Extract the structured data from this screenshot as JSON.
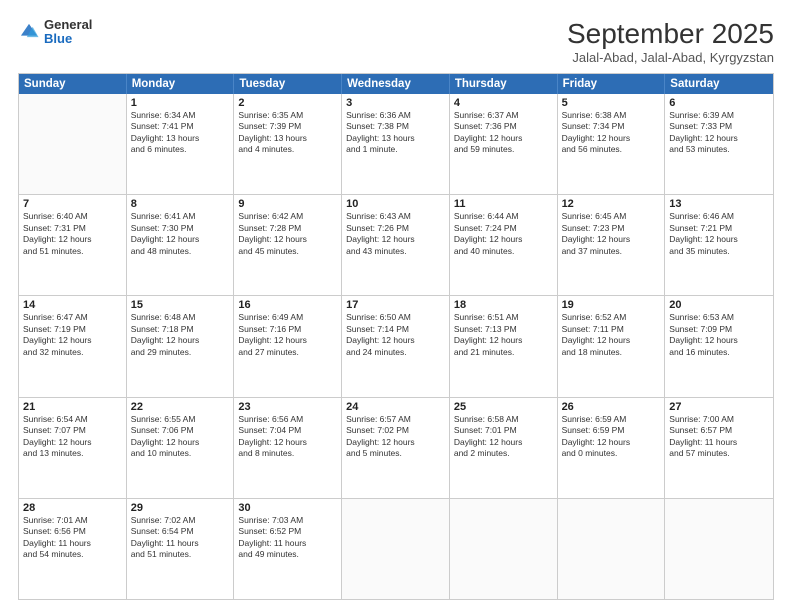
{
  "header": {
    "logo_general": "General",
    "logo_blue": "Blue",
    "month_title": "September 2025",
    "location": "Jalal-Abad, Jalal-Abad, Kyrgyzstan"
  },
  "weekdays": [
    "Sunday",
    "Monday",
    "Tuesday",
    "Wednesday",
    "Thursday",
    "Friday",
    "Saturday"
  ],
  "weeks": [
    [
      {
        "day": "",
        "lines": []
      },
      {
        "day": "1",
        "lines": [
          "Sunrise: 6:34 AM",
          "Sunset: 7:41 PM",
          "Daylight: 13 hours",
          "and 6 minutes."
        ]
      },
      {
        "day": "2",
        "lines": [
          "Sunrise: 6:35 AM",
          "Sunset: 7:39 PM",
          "Daylight: 13 hours",
          "and 4 minutes."
        ]
      },
      {
        "day": "3",
        "lines": [
          "Sunrise: 6:36 AM",
          "Sunset: 7:38 PM",
          "Daylight: 13 hours",
          "and 1 minute."
        ]
      },
      {
        "day": "4",
        "lines": [
          "Sunrise: 6:37 AM",
          "Sunset: 7:36 PM",
          "Daylight: 12 hours",
          "and 59 minutes."
        ]
      },
      {
        "day": "5",
        "lines": [
          "Sunrise: 6:38 AM",
          "Sunset: 7:34 PM",
          "Daylight: 12 hours",
          "and 56 minutes."
        ]
      },
      {
        "day": "6",
        "lines": [
          "Sunrise: 6:39 AM",
          "Sunset: 7:33 PM",
          "Daylight: 12 hours",
          "and 53 minutes."
        ]
      }
    ],
    [
      {
        "day": "7",
        "lines": [
          "Sunrise: 6:40 AM",
          "Sunset: 7:31 PM",
          "Daylight: 12 hours",
          "and 51 minutes."
        ]
      },
      {
        "day": "8",
        "lines": [
          "Sunrise: 6:41 AM",
          "Sunset: 7:30 PM",
          "Daylight: 12 hours",
          "and 48 minutes."
        ]
      },
      {
        "day": "9",
        "lines": [
          "Sunrise: 6:42 AM",
          "Sunset: 7:28 PM",
          "Daylight: 12 hours",
          "and 45 minutes."
        ]
      },
      {
        "day": "10",
        "lines": [
          "Sunrise: 6:43 AM",
          "Sunset: 7:26 PM",
          "Daylight: 12 hours",
          "and 43 minutes."
        ]
      },
      {
        "day": "11",
        "lines": [
          "Sunrise: 6:44 AM",
          "Sunset: 7:24 PM",
          "Daylight: 12 hours",
          "and 40 minutes."
        ]
      },
      {
        "day": "12",
        "lines": [
          "Sunrise: 6:45 AM",
          "Sunset: 7:23 PM",
          "Daylight: 12 hours",
          "and 37 minutes."
        ]
      },
      {
        "day": "13",
        "lines": [
          "Sunrise: 6:46 AM",
          "Sunset: 7:21 PM",
          "Daylight: 12 hours",
          "and 35 minutes."
        ]
      }
    ],
    [
      {
        "day": "14",
        "lines": [
          "Sunrise: 6:47 AM",
          "Sunset: 7:19 PM",
          "Daylight: 12 hours",
          "and 32 minutes."
        ]
      },
      {
        "day": "15",
        "lines": [
          "Sunrise: 6:48 AM",
          "Sunset: 7:18 PM",
          "Daylight: 12 hours",
          "and 29 minutes."
        ]
      },
      {
        "day": "16",
        "lines": [
          "Sunrise: 6:49 AM",
          "Sunset: 7:16 PM",
          "Daylight: 12 hours",
          "and 27 minutes."
        ]
      },
      {
        "day": "17",
        "lines": [
          "Sunrise: 6:50 AM",
          "Sunset: 7:14 PM",
          "Daylight: 12 hours",
          "and 24 minutes."
        ]
      },
      {
        "day": "18",
        "lines": [
          "Sunrise: 6:51 AM",
          "Sunset: 7:13 PM",
          "Daylight: 12 hours",
          "and 21 minutes."
        ]
      },
      {
        "day": "19",
        "lines": [
          "Sunrise: 6:52 AM",
          "Sunset: 7:11 PM",
          "Daylight: 12 hours",
          "and 18 minutes."
        ]
      },
      {
        "day": "20",
        "lines": [
          "Sunrise: 6:53 AM",
          "Sunset: 7:09 PM",
          "Daylight: 12 hours",
          "and 16 minutes."
        ]
      }
    ],
    [
      {
        "day": "21",
        "lines": [
          "Sunrise: 6:54 AM",
          "Sunset: 7:07 PM",
          "Daylight: 12 hours",
          "and 13 minutes."
        ]
      },
      {
        "day": "22",
        "lines": [
          "Sunrise: 6:55 AM",
          "Sunset: 7:06 PM",
          "Daylight: 12 hours",
          "and 10 minutes."
        ]
      },
      {
        "day": "23",
        "lines": [
          "Sunrise: 6:56 AM",
          "Sunset: 7:04 PM",
          "Daylight: 12 hours",
          "and 8 minutes."
        ]
      },
      {
        "day": "24",
        "lines": [
          "Sunrise: 6:57 AM",
          "Sunset: 7:02 PM",
          "Daylight: 12 hours",
          "and 5 minutes."
        ]
      },
      {
        "day": "25",
        "lines": [
          "Sunrise: 6:58 AM",
          "Sunset: 7:01 PM",
          "Daylight: 12 hours",
          "and 2 minutes."
        ]
      },
      {
        "day": "26",
        "lines": [
          "Sunrise: 6:59 AM",
          "Sunset: 6:59 PM",
          "Daylight: 12 hours",
          "and 0 minutes."
        ]
      },
      {
        "day": "27",
        "lines": [
          "Sunrise: 7:00 AM",
          "Sunset: 6:57 PM",
          "Daylight: 11 hours",
          "and 57 minutes."
        ]
      }
    ],
    [
      {
        "day": "28",
        "lines": [
          "Sunrise: 7:01 AM",
          "Sunset: 6:56 PM",
          "Daylight: 11 hours",
          "and 54 minutes."
        ]
      },
      {
        "day": "29",
        "lines": [
          "Sunrise: 7:02 AM",
          "Sunset: 6:54 PM",
          "Daylight: 11 hours",
          "and 51 minutes."
        ]
      },
      {
        "day": "30",
        "lines": [
          "Sunrise: 7:03 AM",
          "Sunset: 6:52 PM",
          "Daylight: 11 hours",
          "and 49 minutes."
        ]
      },
      {
        "day": "",
        "lines": []
      },
      {
        "day": "",
        "lines": []
      },
      {
        "day": "",
        "lines": []
      },
      {
        "day": "",
        "lines": []
      }
    ]
  ]
}
